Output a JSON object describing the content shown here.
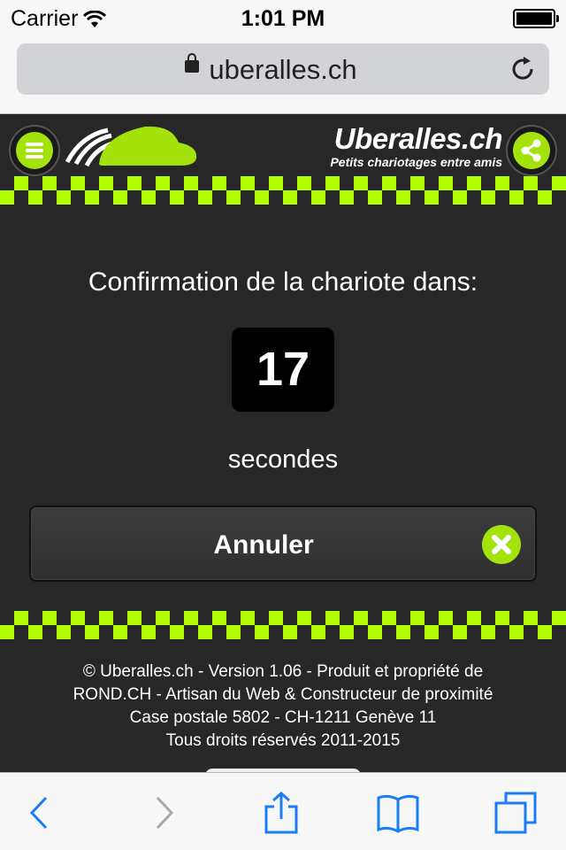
{
  "status_bar": {
    "carrier": "Carrier",
    "time": "1:01 PM"
  },
  "browser": {
    "url": "uberalles.ch"
  },
  "site": {
    "brand_name": "Uberalles.ch",
    "tagline": "Petits chariotages entre amis",
    "accent_color": "#a4e20b"
  },
  "main": {
    "confirm_text": "Confirmation de la chariote dans:",
    "countdown": "17",
    "seconds_label": "secondes",
    "cancel_label": "Annuler"
  },
  "footer": {
    "line1": "© Uberalles.ch - Version 1.06 - Produit et propriété de",
    "line2": "ROND.CH - Artisan du Web & Constructeur de proximité",
    "line3": "Case postale 5802 - CH-1211 Genève 11",
    "line4": "Tous droits réservés 2011-2015"
  },
  "icons": {
    "wifi": "wifi-icon",
    "battery": "battery-icon",
    "lock": "lock-icon",
    "reload": "reload-icon",
    "menu": "hamburger-menu-icon",
    "share": "share-icon",
    "close": "close-x-icon",
    "back": "back-arrow-icon",
    "forward": "forward-arrow-icon",
    "share_toolbar": "share-upload-icon",
    "bookmarks": "bookmarks-icon",
    "tabs": "tabs-icon"
  }
}
